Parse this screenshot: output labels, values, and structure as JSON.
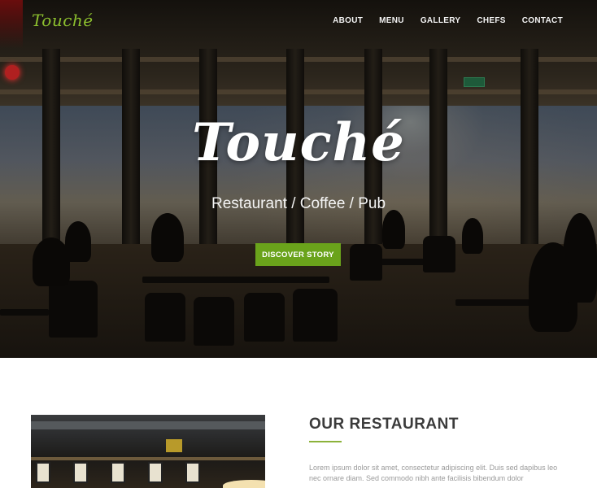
{
  "brand": {
    "logo_text": "Touché"
  },
  "nav": {
    "items": [
      {
        "label": "ABOUT"
      },
      {
        "label": "MENU"
      },
      {
        "label": "GALLERY"
      },
      {
        "label": "CHEFS"
      },
      {
        "label": "CONTACT"
      }
    ]
  },
  "hero": {
    "title": "Touché",
    "subtitle": "Restaurant / Coffee / Pub",
    "cta_label": "DISCOVER STORY"
  },
  "about": {
    "title": "OUR RESTAURANT",
    "text": "Lorem ipsum dolor sit amet, consectetur adipiscing elit. Duis sed dapibus leo nec ornare diam. Sed commodo nibh ante facilisis bibendum dolor"
  },
  "colors": {
    "accent": "#6aa31b",
    "logo": "#8cbf2e",
    "underline": "#8cb23a"
  }
}
